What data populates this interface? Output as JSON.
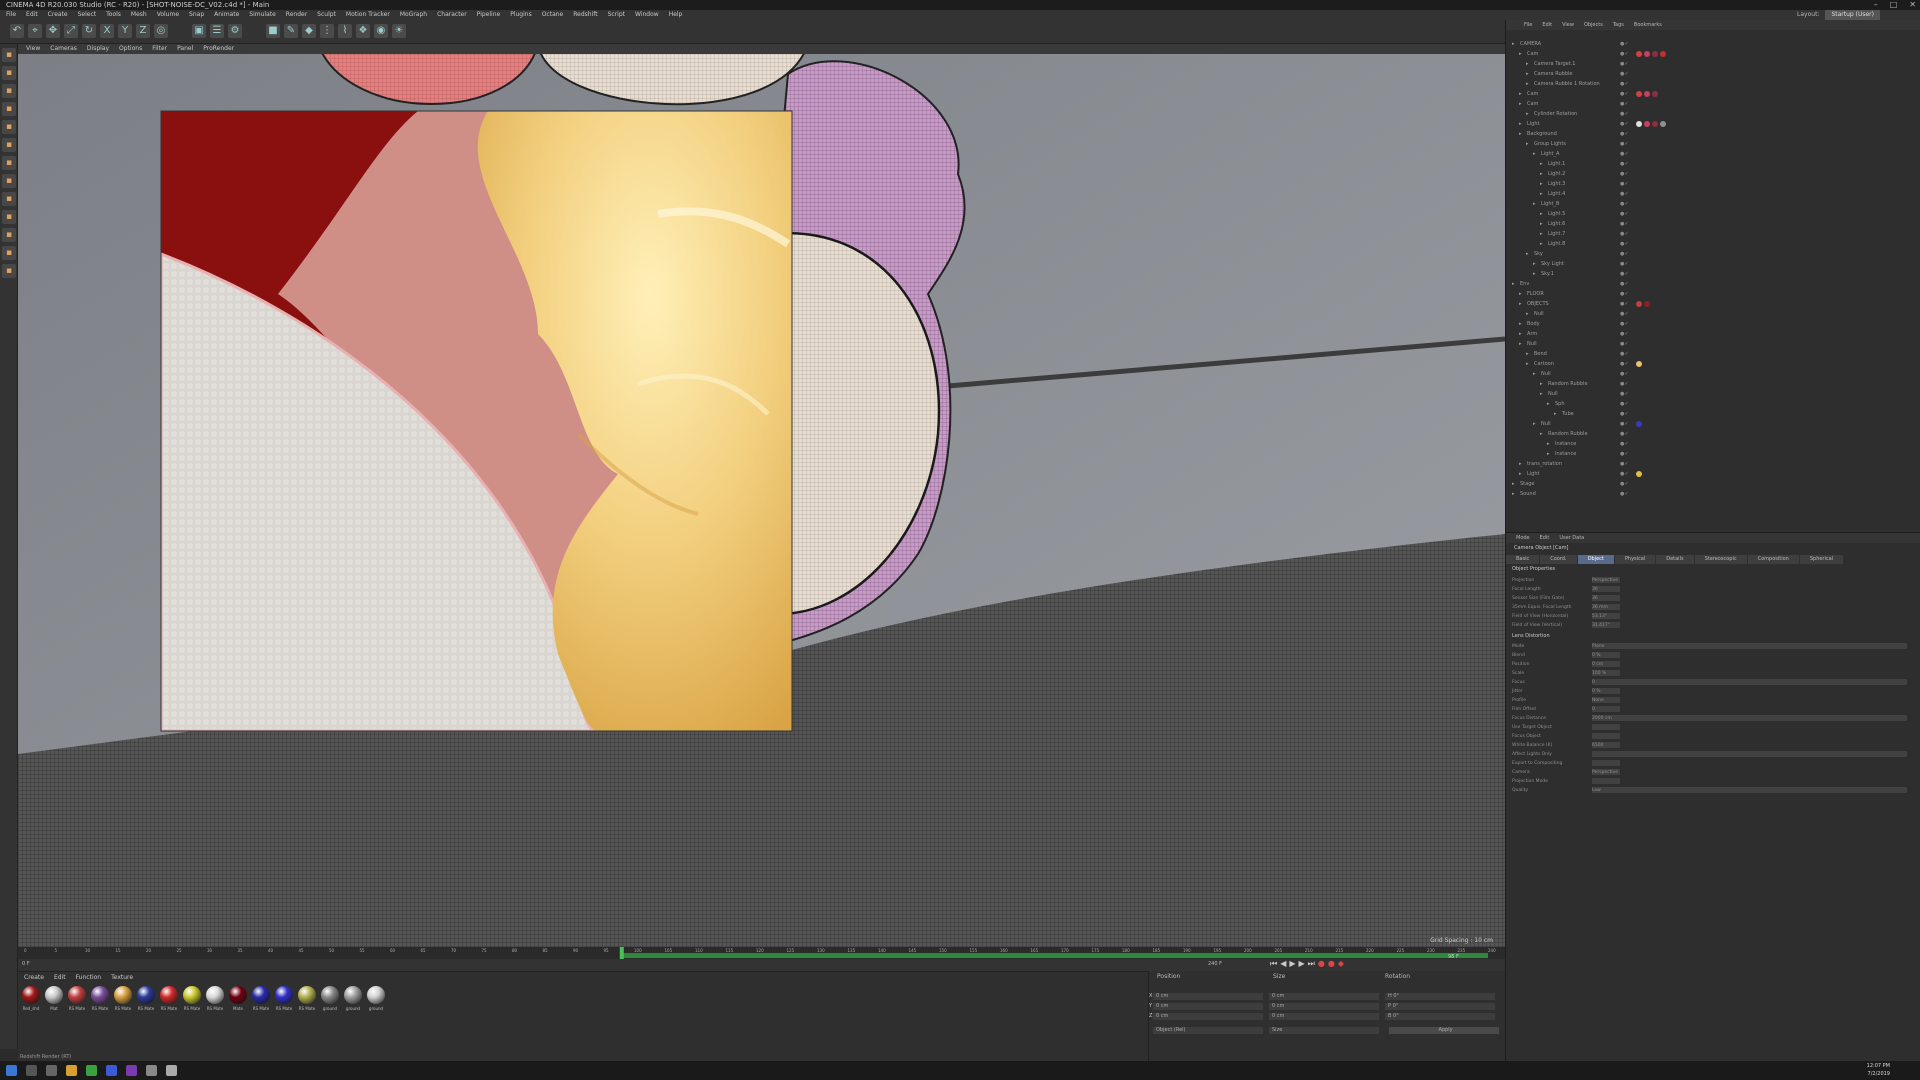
{
  "window": {
    "title": "CINEMA 4D R20.030 Studio (RC - R20) - [SHOT-NOISE-DC_V02.c4d *] - Main",
    "controls": [
      "–",
      "□",
      "✕"
    ]
  },
  "menu": [
    "File",
    "Edit",
    "Create",
    "Select",
    "Tools",
    "Mesh",
    "Volume",
    "Snap",
    "Animate",
    "Simulate",
    "Render",
    "Sculpt",
    "Motion Tracker",
    "MoGraph",
    "Character",
    "Pipeline",
    "Plugins",
    "Octane",
    "Redshift",
    "Script",
    "Window",
    "Help"
  ],
  "layout": {
    "label": "Layout:",
    "value": "Startup (User)"
  },
  "toolbar_icons": [
    "undo-icon",
    "live-select-icon",
    "move-icon",
    "scale-icon",
    "rotate-icon",
    "x-axis-icon",
    "y-axis-icon",
    "z-axis-icon",
    "world-coord-icon",
    "render-view-icon",
    "render-queue-icon",
    "render-settings-icon",
    "cube-icon",
    "pen-icon",
    "subdivision-icon",
    "array-icon",
    "deformer-icon",
    "scene-icon",
    "camera-icon",
    "light-icon"
  ],
  "viewport_menu": [
    "View",
    "Cameras",
    "Display",
    "Options",
    "Filter",
    "Panel",
    "ProRender"
  ],
  "viewport_status": "Grid Spacing : 10 cm",
  "timeline": {
    "ticks": [
      "0",
      "5",
      "10",
      "15",
      "20",
      "25",
      "30",
      "35",
      "40",
      "45",
      "50",
      "55",
      "60",
      "65",
      "70",
      "75",
      "80",
      "85",
      "90",
      "95",
      "100",
      "105",
      "110",
      "115",
      "120",
      "125",
      "130",
      "135",
      "140",
      "145",
      "150",
      "155",
      "160",
      "165",
      "170",
      "175",
      "180",
      "185",
      "190",
      "195",
      "200",
      "205",
      "210",
      "215",
      "220",
      "225",
      "230",
      "235",
      "240"
    ],
    "start_frame": "0 F",
    "end_frame": "240 F",
    "current_frame_value": 98,
    "max_frame": 240,
    "current_frame_readout": "98 F"
  },
  "material_menu": [
    "Create",
    "Edit",
    "Function",
    "Texture"
  ],
  "materials": [
    {
      "name": "Red_shd",
      "color": "#a01818"
    },
    {
      "name": "Mat",
      "color": "#c9c9c9"
    },
    {
      "name": "RS Mate",
      "color": "#c04040"
    },
    {
      "name": "RS Mate",
      "color": "#7a4e9a"
    },
    {
      "name": "RS Mate",
      "color": "#d8a040"
    },
    {
      "name": "RS Mate",
      "color": "#2a3a9a"
    },
    {
      "name": "RS Mate",
      "color": "#d02a2a"
    },
    {
      "name": "RS Mate",
      "color": "#c8c830"
    },
    {
      "name": "RS Mate",
      "color": "#d8d8d8"
    },
    {
      "name": "Mate",
      "color": "#700010"
    },
    {
      "name": "RS Mate",
      "color": "#2a2aaa"
    },
    {
      "name": "RS Mate",
      "color": "#3030c8"
    },
    {
      "name": "RS Mate",
      "color": "#b0b050"
    },
    {
      "name": "ground",
      "color": "#8a8a8a"
    },
    {
      "name": "ground",
      "color": "#a0a0a0"
    },
    {
      "name": "ground",
      "color": "#d0d0d0"
    }
  ],
  "coords": {
    "headers": [
      "Position",
      "Size",
      "Rotation"
    ],
    "rows": [
      {
        "axis": "X",
        "pos": "0 cm",
        "size": "0 cm",
        "rot": "H 0°"
      },
      {
        "axis": "Y",
        "pos": "0 cm",
        "size": "0 cm",
        "rot": "P 0°"
      },
      {
        "axis": "Z",
        "pos": "0 cm",
        "size": "0 cm",
        "rot": "B 0°"
      }
    ],
    "mode": "Object (Rel)",
    "size_mode": "Size",
    "apply": "Apply"
  },
  "status_bar": "Redshift Render (RT)",
  "object_manager": {
    "menu": [
      "File",
      "Edit",
      "View",
      "Objects",
      "Tags",
      "Bookmarks"
    ],
    "rows": [
      {
        "name": "CAMERA",
        "depth": 0,
        "tags": []
      },
      {
        "name": "Cam",
        "depth": 1,
        "tags": [
          "#d24040",
          "#c84060",
          "#8a3040",
          "#c03030"
        ]
      },
      {
        "name": "Camera Target.1",
        "depth": 2,
        "tags": []
      },
      {
        "name": "Camera Rubble",
        "depth": 2,
        "tags": []
      },
      {
        "name": "Camera Rubble 1 Rotation",
        "depth": 2,
        "tags": []
      },
      {
        "name": "Cam",
        "depth": 1,
        "tags": [
          "#d24040",
          "#c84060",
          "#8a3040"
        ]
      },
      {
        "name": "Cam",
        "depth": 1,
        "tags": []
      },
      {
        "name": "Cylinder Rotation",
        "depth": 2,
        "tags": []
      },
      {
        "name": "Light",
        "depth": 1,
        "tags": [
          "#e0e0e0",
          "#c84060",
          "#8a3040",
          "#909090"
        ]
      },
      {
        "name": "Background",
        "depth": 1,
        "tags": []
      },
      {
        "name": "Group Lights",
        "depth": 2,
        "tags": []
      },
      {
        "name": "Light_A",
        "depth": 3,
        "tags": []
      },
      {
        "name": "Light.1",
        "depth": 4,
        "tags": []
      },
      {
        "name": "Light.2",
        "depth": 4,
        "tags": []
      },
      {
        "name": "Light.3",
        "depth": 4,
        "tags": []
      },
      {
        "name": "Light.4",
        "depth": 4,
        "tags": []
      },
      {
        "name": "Light_B",
        "depth": 3,
        "tags": []
      },
      {
        "name": "Light.5",
        "depth": 4,
        "tags": []
      },
      {
        "name": "Light.6",
        "depth": 4,
        "tags": []
      },
      {
        "name": "Light.7",
        "depth": 4,
        "tags": []
      },
      {
        "name": "Light.8",
        "depth": 4,
        "tags": []
      },
      {
        "name": "Sky",
        "depth": 2,
        "tags": []
      },
      {
        "name": "Sky Light",
        "depth": 3,
        "tags": []
      },
      {
        "name": "Sky.1",
        "depth": 3,
        "tags": []
      },
      {
        "name": "Env",
        "depth": 0,
        "tags": []
      },
      {
        "name": "FLOOR",
        "depth": 1,
        "tags": []
      },
      {
        "name": "OBJECTS",
        "depth": 1,
        "tags": [
          "#c04040",
          "#902020"
        ]
      },
      {
        "name": "Null",
        "depth": 2,
        "tags": []
      },
      {
        "name": "Body",
        "depth": 1,
        "tags": []
      },
      {
        "name": "Arm",
        "depth": 1,
        "tags": []
      },
      {
        "name": "Null",
        "depth": 1,
        "tags": []
      },
      {
        "name": "Bend",
        "depth": 2,
        "tags": []
      },
      {
        "name": "Cartoon",
        "depth": 2,
        "tags": [
          "#e8c070"
        ]
      },
      {
        "name": "Null",
        "depth": 3,
        "tags": []
      },
      {
        "name": "Random Rubble",
        "depth": 4,
        "tags": []
      },
      {
        "name": "Null",
        "depth": 4,
        "tags": []
      },
      {
        "name": "Sph",
        "depth": 5,
        "tags": []
      },
      {
        "name": "Tube",
        "depth": 6,
        "tags": []
      },
      {
        "name": "Null",
        "depth": 3,
        "tags": [
          "#3a3ac0"
        ]
      },
      {
        "name": "Random Rubble",
        "depth": 4,
        "tags": []
      },
      {
        "name": "Instance",
        "depth": 5,
        "tags": []
      },
      {
        "name": "Instance",
        "depth": 5,
        "tags": []
      },
      {
        "name": "trans_rotation",
        "depth": 1,
        "tags": []
      },
      {
        "name": "Light",
        "depth": 1,
        "tags": [
          "#e0c040"
        ]
      },
      {
        "name": "Stage",
        "depth": 0,
        "tags": []
      },
      {
        "name": "Sound",
        "depth": 0,
        "tags": []
      }
    ]
  },
  "attribute_manager": {
    "menu": [
      "Mode",
      "Edit",
      "User Data"
    ],
    "title": "Camera Object [Cam]",
    "tabs": [
      "Basic",
      "Coord.",
      "Object",
      "Physical",
      "Details",
      "Stereoscopic",
      "Composition",
      "Spherical"
    ],
    "active_tab_index": 2,
    "section1": "Object Properties",
    "rows1": [
      {
        "label": "Projection",
        "value": "Perspective"
      },
      {
        "label": "Focal Length",
        "value": "36"
      },
      {
        "label": "Sensor Size (Film Gate)",
        "value": "36"
      },
      {
        "label": "35mm Equiv. Focal Length",
        "value": "36 mm"
      },
      {
        "label": "Field of View (Horizontal)",
        "value": "53.13°"
      },
      {
        "label": "Field of View (Vertical)",
        "value": "31.417°"
      }
    ],
    "section2": "Lens Distortion",
    "rows2": [
      {
        "label": "Mode",
        "value": "Plane"
      },
      {
        "label": "Blend",
        "value": "0 %"
      },
      {
        "label": "Position",
        "value": "0 cm"
      },
      {
        "label": "Scale",
        "value": "100 %"
      },
      {
        "label": "Focus",
        "value": "0"
      },
      {
        "label": "Jitter",
        "value": "0 %"
      },
      {
        "label": "Profile",
        "value": "None"
      },
      {
        "label": "Film Offset",
        "value": "0"
      },
      {
        "label": "Focus Distance",
        "value": "2000 cm"
      },
      {
        "label": "Use Target Object",
        "value": ""
      },
      {
        "label": "Focus Object",
        "value": ""
      },
      {
        "label": "White Balance (K)",
        "value": "6500"
      },
      {
        "label": "Affect Lights Only",
        "value": ""
      },
      {
        "label": "Export to Compositing",
        "value": ""
      },
      {
        "label": "Camera",
        "value": "Perspective"
      },
      {
        "label": "Projection Mode",
        "value": ""
      },
      {
        "label": "Quality",
        "value": "Low"
      }
    ]
  },
  "taskbar": {
    "time": "12:07 PM",
    "date": "7/2/2019"
  }
}
